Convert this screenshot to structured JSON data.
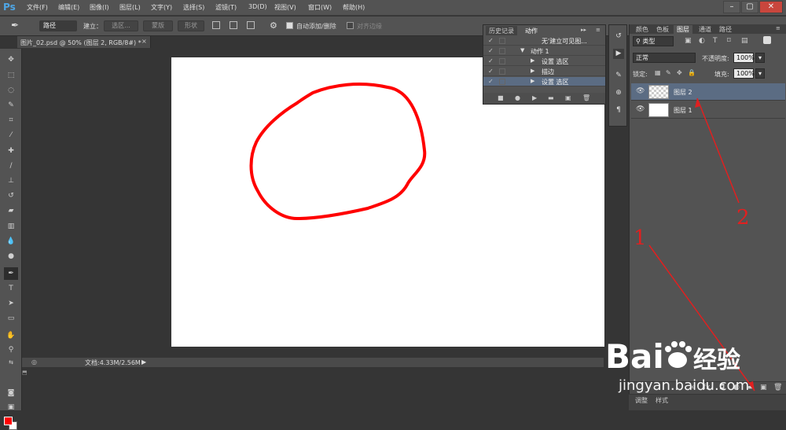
{
  "app": {
    "logo": "Ps"
  },
  "menu": [
    "文件(F)",
    "编辑(E)",
    "图像(I)",
    "图层(L)",
    "文字(Y)",
    "选择(S)",
    "滤镜(T)",
    "3D(D)",
    "视图(V)",
    "窗口(W)",
    "帮助(H)"
  ],
  "window_controls": {
    "minimize": "–",
    "restore": "▢",
    "close": "✕"
  },
  "options": {
    "mode_select": "路径",
    "make_label": "建立：",
    "selection_btn": "选区...",
    "mask_btn": "蒙版",
    "shape_btn": "形状",
    "auto_add_delete": "自动添加/删除",
    "align_edges": "对齐边缘"
  },
  "document": {
    "tab_title": "图片_02.psd @ 50% (图层 2, RGB/8#) *",
    "status_size": "文档:4.33M/2.56M"
  },
  "actions_panel": {
    "tabs": [
      "历史记录",
      "动作"
    ],
    "rows": [
      {
        "label": "无'建立可见图...",
        "indent": 0
      },
      {
        "label": "动作 1",
        "indent": 1
      },
      {
        "label": "设置 选区",
        "indent": 2
      },
      {
        "label": "描边",
        "indent": 2
      },
      {
        "label": "设置 选区",
        "indent": 2
      }
    ]
  },
  "layers_panel": {
    "tabs": [
      "颜色",
      "色板",
      "图层",
      "通道",
      "路径"
    ],
    "filter_kind": "类型",
    "blend_mode": "正常",
    "opacity_label": "不透明度:",
    "opacity_value": "100%",
    "lock_label": "锁定:",
    "fill_label": "填充:",
    "fill_value": "100%",
    "layers": [
      {
        "name": "图层 2",
        "selected": true
      },
      {
        "name": "图层 1",
        "selected": false
      }
    ]
  },
  "adjustments_tabs": [
    "调整",
    "样式"
  ],
  "annotations": {
    "one": "1",
    "two": "2"
  },
  "watermark": {
    "logo_text": "Bai 经验",
    "url": "jingyan.baidu.com"
  },
  "colors": {
    "foreground": "#ff0000",
    "background": "#ffffff",
    "stroke": "#ff0000",
    "selected_layer": "#5b6c83"
  }
}
